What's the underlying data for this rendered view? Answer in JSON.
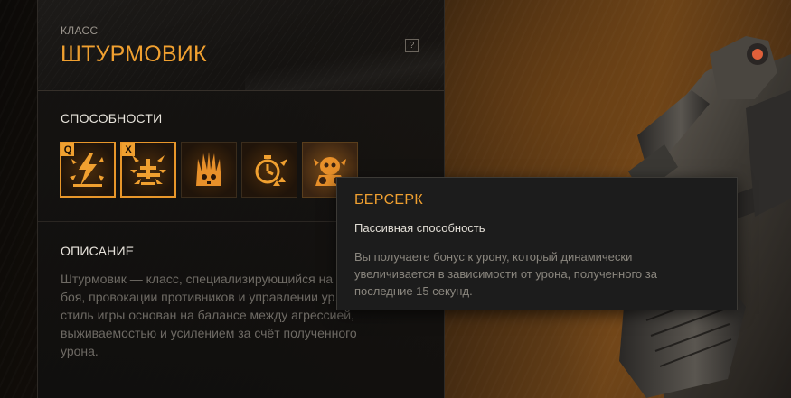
{
  "panel": {
    "class_label": "КЛАСС",
    "class_name": "ШТУРМОВИК",
    "help_label": "?",
    "abilities_title": "СПОСОБНОСТИ",
    "abilities": [
      {
        "icon": "lightning-burst-icon",
        "key": "Q",
        "state": "active"
      },
      {
        "icon": "shield-blast-icon",
        "key": "X",
        "state": "active"
      },
      {
        "icon": "skull-flame-icon",
        "key": "",
        "state": "idle"
      },
      {
        "icon": "stopwatch-blood-icon",
        "key": "",
        "state": "idle"
      },
      {
        "icon": "berserk-head-icon",
        "key": "",
        "state": "hover"
      }
    ],
    "description_title": "ОПИСАНИЕ",
    "description": "Штурмовик — класс, специализирующийся на бл... боя, провокации противников и управлении ур... стиль игры основан на балансе между агрессией, выживаемостью и усилением за счёт полученного урона."
  },
  "tooltip": {
    "title": "БЕРСЕРК",
    "subtitle": "Пассивная способность",
    "body": "Вы получаете бонус к урону, который динамически увеличивается в зависимости от урона, полученного за последние 15 секунд."
  },
  "colors": {
    "accent": "#f0a030",
    "text_primary": "#e8e4dc",
    "text_muted": "#6e6a64",
    "panel_bg": "#161412",
    "tooltip_bg": "#1c1c1c"
  }
}
